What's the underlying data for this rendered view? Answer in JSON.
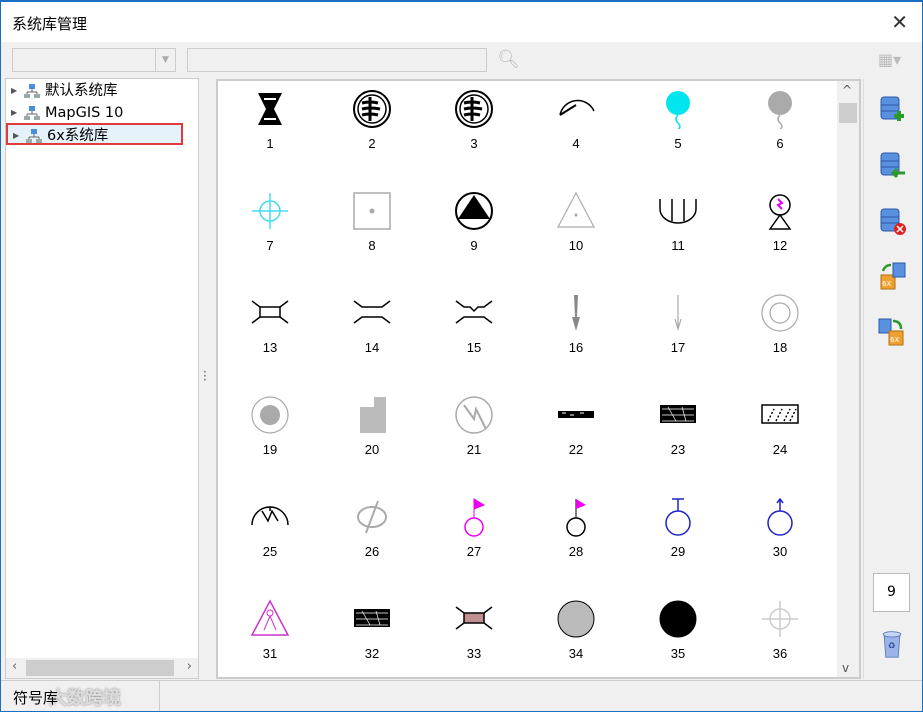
{
  "window": {
    "title": "系统库管理",
    "close_icon": "close-icon"
  },
  "toolbar": {
    "combo_value": "",
    "search_value": "",
    "search_icon": "magnifier-icon",
    "view_icon": "view-grid-icon"
  },
  "tree": {
    "items": [
      {
        "label": "默认系统库",
        "selected": false
      },
      {
        "label": "MapGIS 10",
        "selected": false
      },
      {
        "label": "6x系统库",
        "selected": true
      }
    ]
  },
  "symbols": [
    {
      "n": "1",
      "icon": "ornate-x",
      "color": "#000000"
    },
    {
      "n": "2",
      "icon": "circle-branches",
      "color": "#000000"
    },
    {
      "n": "3",
      "icon": "circle-branches-alt",
      "color": "#000000"
    },
    {
      "n": "4",
      "icon": "gauge",
      "color": "#000000"
    },
    {
      "n": "5",
      "icon": "balloon",
      "color": "#00e5ee"
    },
    {
      "n": "6",
      "icon": "balloon",
      "color": "#aaaaaa"
    },
    {
      "n": "7",
      "icon": "crosshair",
      "color": "#44ddee"
    },
    {
      "n": "8",
      "icon": "square-dot",
      "color": "#aaaaaa"
    },
    {
      "n": "9",
      "icon": "circle-triangle",
      "color": "#000000"
    },
    {
      "n": "10",
      "icon": "triangle-dot",
      "color": "#aaaaaa"
    },
    {
      "n": "11",
      "icon": "trident",
      "color": "#000000"
    },
    {
      "n": "12",
      "icon": "signal-tower",
      "color": "#000000"
    },
    {
      "n": "13",
      "icon": "bridge-box",
      "color": "#000000"
    },
    {
      "n": "14",
      "icon": "bridge",
      "color": "#000000"
    },
    {
      "n": "15",
      "icon": "bridge-notch",
      "color": "#000000"
    },
    {
      "n": "16",
      "icon": "arrow-down-bold",
      "color": "#888888"
    },
    {
      "n": "17",
      "icon": "arrow-down-thin",
      "color": "#aaaaaa"
    },
    {
      "n": "18",
      "icon": "double-circle",
      "color": "#aaaaaa"
    },
    {
      "n": "19",
      "icon": "circle-filled-ring",
      "color": "#aaaaaa"
    },
    {
      "n": "20",
      "icon": "building",
      "color": "#bbbbbb"
    },
    {
      "n": "21",
      "icon": "circle-lightning",
      "color": "#aaaaaa"
    },
    {
      "n": "22",
      "icon": "chain-pattern",
      "color": "#000000"
    },
    {
      "n": "23",
      "icon": "hatched-block",
      "color": "#000000"
    },
    {
      "n": "24",
      "icon": "hatched-rect",
      "color": "#000000"
    },
    {
      "n": "25",
      "icon": "fan",
      "color": "#000000"
    },
    {
      "n": "26",
      "icon": "slashed-ellipse",
      "color": "#aaaaaa"
    },
    {
      "n": "27",
      "icon": "flag-circle",
      "color": "#ee00ee"
    },
    {
      "n": "28",
      "icon": "flag-circle-black",
      "color": "#000000"
    },
    {
      "n": "29",
      "icon": "circle-tee",
      "color": "#2222cc"
    },
    {
      "n": "30",
      "icon": "circle-arrow",
      "color": "#2222cc"
    },
    {
      "n": "31",
      "icon": "triangle-figure",
      "color": "#cc33cc"
    },
    {
      "n": "32",
      "icon": "hatched-block",
      "color": "#000000"
    },
    {
      "n": "33",
      "icon": "bridge-box-fill",
      "color": "#c09090"
    },
    {
      "n": "34",
      "icon": "circle-fill",
      "color": "#bbbbbb"
    },
    {
      "n": "35",
      "icon": "circle-fill",
      "color": "#000000"
    },
    {
      "n": "36",
      "icon": "crosshair",
      "color": "#cccccc"
    }
  ],
  "right_toolbar": {
    "buttons": [
      "add-library-icon",
      "import-library-icon",
      "delete-library-icon",
      "convert-from-6x-icon",
      "convert-to-6x-icon"
    ],
    "page_value": "9",
    "recycle_icon": "recycle-bin-icon"
  },
  "status": {
    "text": "符号库",
    "watermark": "大数跨境"
  }
}
